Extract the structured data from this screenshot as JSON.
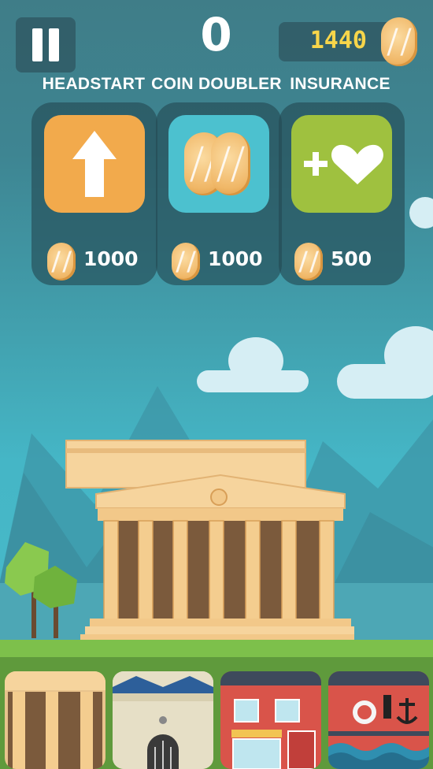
{
  "hud": {
    "score": "0",
    "coins": "1440"
  },
  "powerups": [
    {
      "label": "HEADSTART",
      "price": "1000",
      "icon": "arrow-up-icon",
      "color": "#f2aa4c"
    },
    {
      "label": "COIN DOUBLER",
      "price": "1000",
      "icon": "double-coin-icon",
      "color": "#4cc1cf"
    },
    {
      "label": "INSURANCE",
      "price": "500",
      "icon": "plus-heart-icon",
      "color": "#9fc13f"
    }
  ],
  "buildings": [
    {
      "name": "temple",
      "icon": "greek-temple-icon"
    },
    {
      "name": "castle",
      "icon": "castle-icon"
    },
    {
      "name": "shop",
      "icon": "red-shop-icon"
    },
    {
      "name": "harbor",
      "icon": "harbor-icon"
    }
  ],
  "colors": {
    "coin_text": "#f7d54a",
    "grass": "#7dc04b",
    "sky": "#45b6c6"
  }
}
